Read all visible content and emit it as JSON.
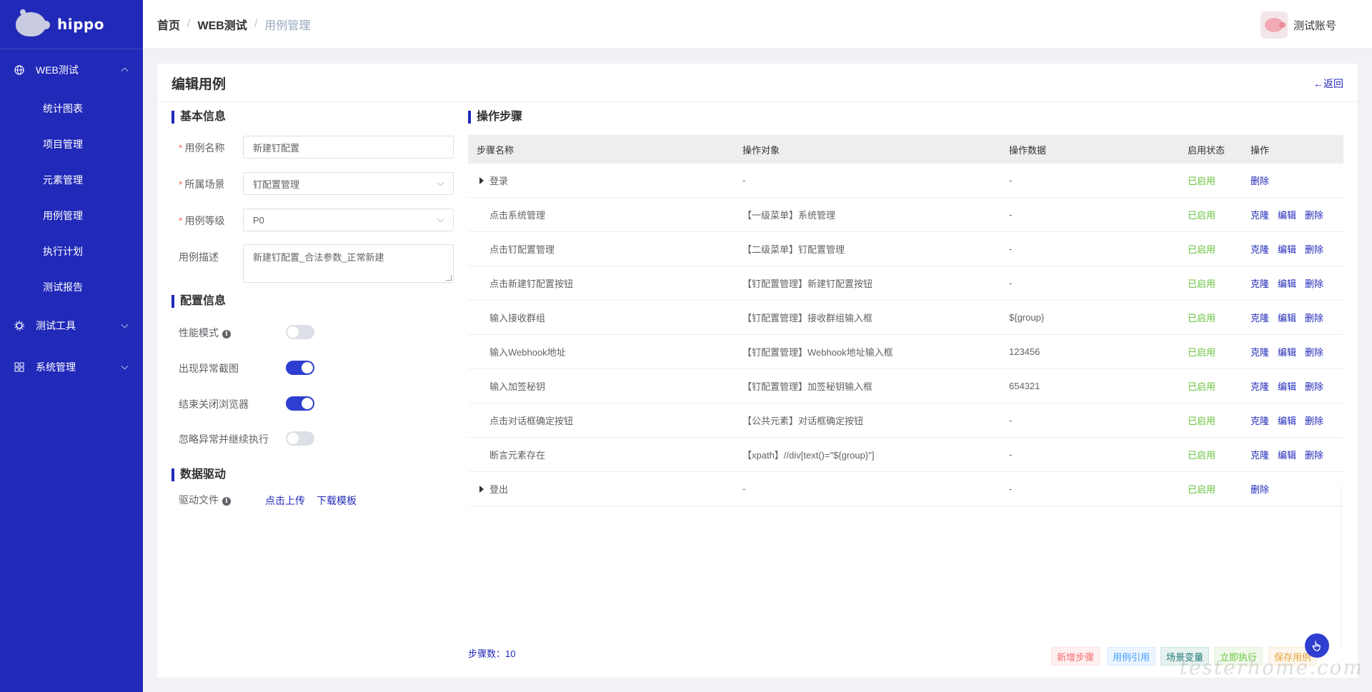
{
  "brand": {
    "name": "hippo"
  },
  "sidebar": {
    "groups": [
      {
        "label": "WEB测试",
        "items": [
          {
            "label": "统计图表"
          },
          {
            "label": "项目管理"
          },
          {
            "label": "元素管理"
          },
          {
            "label": "用例管理"
          },
          {
            "label": "执行计划"
          },
          {
            "label": "测试报告"
          }
        ]
      },
      {
        "label": "测试工具"
      },
      {
        "label": "系统管理"
      }
    ]
  },
  "breadcrumb": [
    "首页",
    "WEB测试",
    "用例管理"
  ],
  "user": {
    "name": "测试账号"
  },
  "page": {
    "title": "编辑用例",
    "back": "←返回"
  },
  "basic": {
    "title": "基本信息",
    "name_label": "用例名称",
    "name_value": "新建钉配置",
    "scene_label": "所属场景",
    "scene_value": "钉配置管理",
    "level_label": "用例等级",
    "level_value": "P0",
    "desc_label": "用例描述",
    "desc_value": "新建钉配置_合法参数_正常新建"
  },
  "config": {
    "title": "配置信息",
    "items": [
      {
        "label": "性能模式",
        "on": false
      },
      {
        "label": "出现异常截图",
        "on": true
      },
      {
        "label": "结束关闭浏览器",
        "on": true
      },
      {
        "label": "忽略异常并继续执行",
        "on": false
      }
    ]
  },
  "driver": {
    "title": "数据驱动",
    "file_label": "驱动文件",
    "upload": "点击上传",
    "template": "下载模板"
  },
  "steps": {
    "title": "操作步骤",
    "columns": [
      "步骤名称",
      "操作对象",
      "操作数据",
      "启用状态",
      "操作"
    ],
    "rows": [
      {
        "name": "登录",
        "object": "-",
        "data": "-",
        "status": "已启用",
        "group": true
      },
      {
        "name": "点击系统管理",
        "object": "【一级菜单】系统管理",
        "data": "-",
        "status": "已启用",
        "group": false
      },
      {
        "name": "点击钉配置管理",
        "object": "【二级菜单】钉配置管理",
        "data": "-",
        "status": "已启用",
        "group": false
      },
      {
        "name": "点击新建钉配置按钮",
        "object": "【钉配置管理】新建钉配置按钮",
        "data": "-",
        "status": "已启用",
        "group": false
      },
      {
        "name": "输入接收群组",
        "object": "【钉配置管理】接收群组输入框",
        "data": "${group}",
        "status": "已启用",
        "group": false
      },
      {
        "name": "输入Webhook地址",
        "object": "【钉配置管理】Webhook地址输入框",
        "data": "123456",
        "status": "已启用",
        "group": false
      },
      {
        "name": "输入加签秘钥",
        "object": "【钉配置管理】加签秘钥输入框",
        "data": "654321",
        "status": "已启用",
        "group": false
      },
      {
        "name": "点击对话框确定按钮",
        "object": "【公共元素】对话框确定按钮",
        "data": "-",
        "status": "已启用",
        "group": false
      },
      {
        "name": "断言元素存在",
        "object": "【xpath】//div[text()=\"${group}\"]",
        "data": "-",
        "status": "已启用",
        "group": false
      },
      {
        "name": "登出",
        "object": "-",
        "data": "-",
        "status": "已启用",
        "group": true
      }
    ],
    "op_clone": "克隆",
    "op_edit": "编辑",
    "op_delete": "删除",
    "count_text": "步骤数：10"
  },
  "actions": {
    "add_step": "新增步骤",
    "ref_case": "用例引用",
    "scene_var": "场景变量",
    "run_now": "立即执行",
    "save_case": "保存用例"
  },
  "watermark": "testerhome.com",
  "colors": {
    "primary": "#2129b8",
    "enabled": "#67c23a",
    "danger": "#f56c6c"
  }
}
